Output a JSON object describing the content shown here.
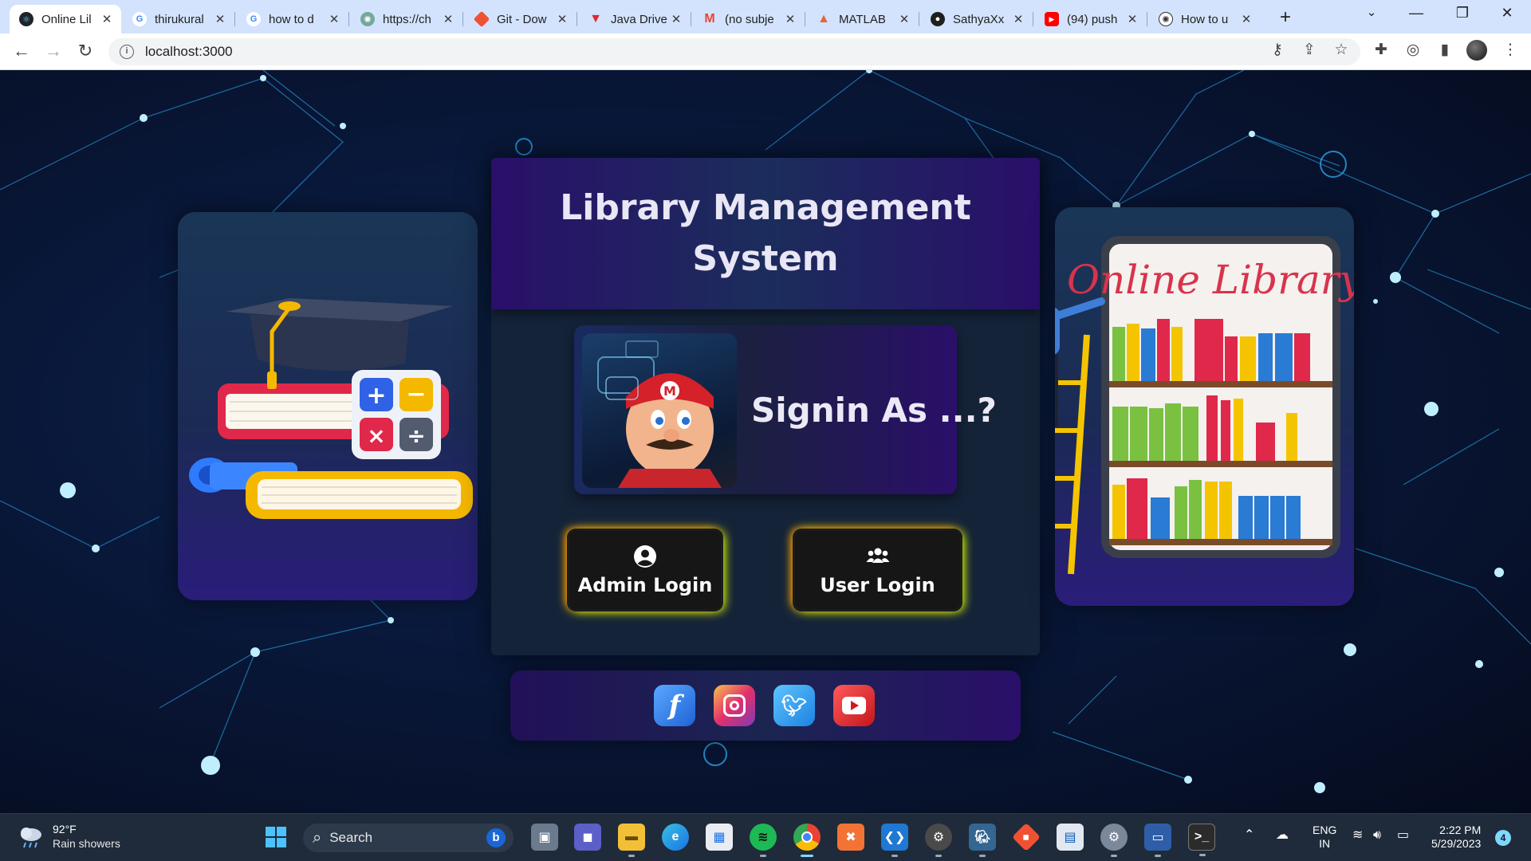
{
  "browser": {
    "tabs": [
      {
        "title": "Online Lil",
        "active": true,
        "icon": "react-icon"
      },
      {
        "title": "thirukural",
        "icon": "google-icon"
      },
      {
        "title": "how to d",
        "icon": "google-icon"
      },
      {
        "title": "https://ch",
        "icon": "chatgpt-icon"
      },
      {
        "title": "Git - Dow",
        "icon": "git-icon"
      },
      {
        "title": "Java Drive",
        "icon": "vercel-icon"
      },
      {
        "title": "(no subje",
        "icon": "gmail-icon"
      },
      {
        "title": "MATLAB",
        "icon": "matlab-icon"
      },
      {
        "title": "SathyaXx",
        "icon": "github-icon"
      },
      {
        "title": "(94) push",
        "icon": "youtube-icon"
      },
      {
        "title": "How to u",
        "icon": "openai-icon"
      }
    ],
    "url": "localhost:3000"
  },
  "page": {
    "title": "Library Management System",
    "signin_prompt": "Signin As ...?",
    "admin_login_label": "Admin Login",
    "user_login_label": "User Login",
    "bookshelf_sign": "Online Library",
    "social": [
      "facebook-icon",
      "instagram-icon",
      "twitter-icon",
      "youtube-icon"
    ]
  },
  "taskbar": {
    "weather_temp": "92°F",
    "weather_desc": "Rain showers",
    "search_placeholder": "Search",
    "lang_line1": "ENG",
    "lang_line2": "IN",
    "time": "2:22 PM",
    "date": "5/29/2023",
    "notifications": "4"
  },
  "colors": {
    "tabstrip": "#d3e3fd",
    "card": "#142338",
    "button_glow_left": "#ff8a00",
    "button_glow_right": "#b7ff00"
  }
}
